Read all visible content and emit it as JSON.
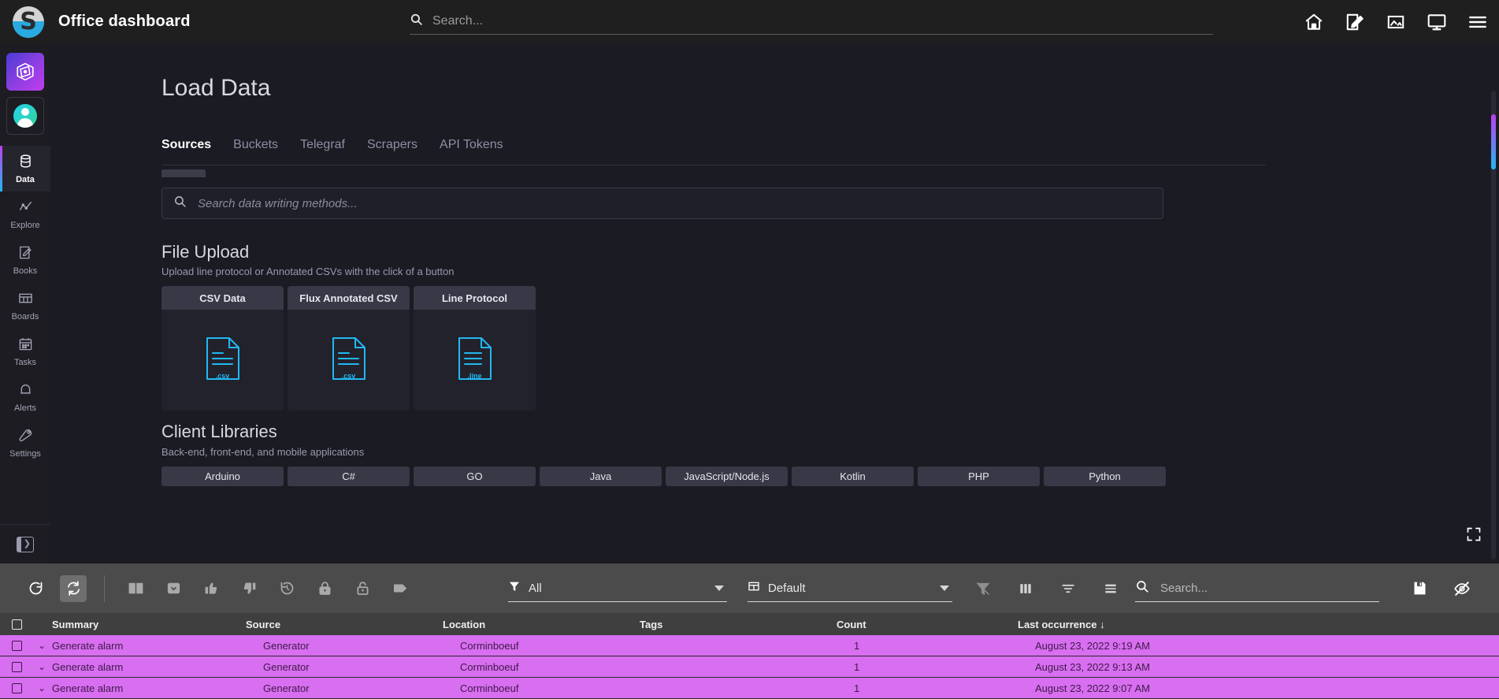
{
  "topbar": {
    "app_title": "Office dashboard",
    "logo_glyph": "S",
    "search_placeholder": "Search...",
    "icons": [
      {
        "name": "home-icon",
        "label": "Home"
      },
      {
        "name": "edit-icon",
        "label": "Edit"
      },
      {
        "name": "image-icon",
        "label": "Image"
      },
      {
        "name": "monitor-icon",
        "label": "Monitor"
      },
      {
        "name": "menu-icon",
        "label": "Menu"
      }
    ]
  },
  "sidebar": {
    "items": [
      {
        "label": "Data",
        "icon": "database-icon",
        "active": true
      },
      {
        "label": "Explore",
        "icon": "graph-line-icon",
        "active": false
      },
      {
        "label": "Books",
        "icon": "notebook-icon",
        "active": false
      },
      {
        "label": "Boards",
        "icon": "dashboard-grid-icon",
        "active": false
      },
      {
        "label": "Tasks",
        "icon": "calendar-icon",
        "active": false
      },
      {
        "label": "Alerts",
        "icon": "bell-icon",
        "active": false
      },
      {
        "label": "Settings",
        "icon": "wrench-icon",
        "active": false
      }
    ]
  },
  "main": {
    "page_title": "Load Data",
    "tabs": [
      {
        "label": "Sources",
        "active": true
      },
      {
        "label": "Buckets",
        "active": false
      },
      {
        "label": "Telegraf",
        "active": false
      },
      {
        "label": "Scrapers",
        "active": false
      },
      {
        "label": "API Tokens",
        "active": false
      }
    ],
    "search_placeholder": "Search data writing methods...",
    "file_upload": {
      "title": "File Upload",
      "subtitle": "Upload line protocol or Annotated CSVs with the click of a button",
      "cards": [
        {
          "title": "CSV Data",
          "filetype": ".csv"
        },
        {
          "title": "Flux Annotated CSV",
          "filetype": ".csv"
        },
        {
          "title": "Line Protocol",
          "filetype": ".line"
        }
      ]
    },
    "client_libraries": {
      "title": "Client Libraries",
      "subtitle": "Back-end, front-end, and mobile applications",
      "items": [
        "Arduino",
        "C#",
        "GO",
        "Java",
        "JavaScript/Node.js",
        "Kotlin",
        "PHP",
        "Python"
      ]
    }
  },
  "toolbar": {
    "buttons": [
      {
        "name": "refresh-icon",
        "label": "Refresh",
        "selected": false
      },
      {
        "name": "auto-refresh-icon",
        "label": "Auto refresh",
        "selected": true
      },
      {
        "name": "book-icon",
        "label": "Journal",
        "selected": false
      },
      {
        "name": "archive-icon",
        "label": "Archive",
        "selected": false
      },
      {
        "name": "thumbs-up-icon",
        "label": "Acknowledge",
        "selected": false
      },
      {
        "name": "thumbs-down-icon",
        "label": "Reject",
        "selected": false
      },
      {
        "name": "history-icon",
        "label": "History",
        "selected": false
      },
      {
        "name": "lock-closed-icon",
        "label": "Lock",
        "selected": false
      },
      {
        "name": "lock-open-icon",
        "label": "Unlock",
        "selected": false
      },
      {
        "name": "tag-icon",
        "label": "Tag",
        "selected": false
      }
    ],
    "filter_select": {
      "value": "All",
      "icon": "funnel-icon"
    },
    "view_select": {
      "value": "Default",
      "icon": "table-icon"
    },
    "right_buttons": [
      {
        "name": "clear-filter-icon",
        "label": "Clear filter"
      },
      {
        "name": "columns-icon",
        "label": "Columns"
      },
      {
        "name": "filter-lines-icon",
        "label": "Filter"
      },
      {
        "name": "row-height-icon",
        "label": "Row height"
      }
    ],
    "search_placeholder": "Search...",
    "end_buttons": [
      {
        "name": "save-icon",
        "label": "Save"
      },
      {
        "name": "eye-off-icon",
        "label": "Hide"
      }
    ]
  },
  "table": {
    "columns": [
      "Summary",
      "Source",
      "Location",
      "Tags",
      "Count",
      "Last occurrence"
    ],
    "sort_column": "Last occurrence",
    "sort_direction": "↓",
    "rows": [
      {
        "summary": "Generate alarm",
        "source": "Generator",
        "location": "Corminboeuf",
        "tags": "",
        "count": "1",
        "last_occurrence": "August 23, 2022 9:19 AM"
      },
      {
        "summary": "Generate alarm",
        "source": "Generator",
        "location": "Corminboeuf",
        "tags": "",
        "count": "1",
        "last_occurrence": "August 23, 2022 9:13 AM"
      },
      {
        "summary": "Generate alarm",
        "source": "Generator",
        "location": "Corminboeuf",
        "tags": "",
        "count": "1",
        "last_occurrence": "August 23, 2022 9:07 AM"
      }
    ]
  },
  "colors": {
    "topbar_bg": "#1f1f1f",
    "sidebar_bg": "#1c1c22",
    "content_bg": "#1a1b23",
    "toolbar_bg": "#4b4b4b",
    "row_highlight": "#d86ef0",
    "accent_blue": "#22b8f0",
    "accent_purple": "#c13df0"
  }
}
